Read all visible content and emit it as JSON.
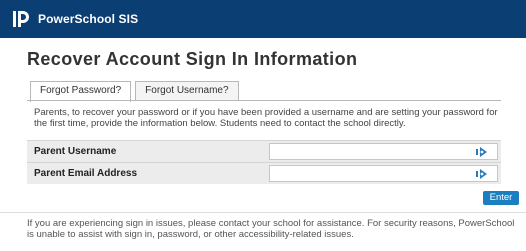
{
  "header": {
    "brand": "PowerSchool SIS",
    "logo_icon": "powerschool-logo-icon"
  },
  "page": {
    "title": "Recover Account Sign In Information"
  },
  "tabs": [
    {
      "label": "Forgot Password?",
      "active": true
    },
    {
      "label": "Forgot Username?",
      "active": false
    }
  ],
  "intro": "Parents, to recover your password or if you have been provided a username and are setting your password for the first time, provide the information below. Students need to contact the school directly.",
  "form": {
    "fields": [
      {
        "label": "Parent Username",
        "value": "",
        "icon": "password-manager-icon"
      },
      {
        "label": "Parent Email Address",
        "value": "",
        "icon": "password-manager-icon"
      }
    ],
    "submit_label": "Enter"
  },
  "footer_note": "If you are experiencing sign in issues, please contact your school for assistance. For security reasons, PowerSchool is unable to assist with sign in, password, or other accessibility-related issues.",
  "colors": {
    "header_bg": "#0b3e73",
    "button_bg": "#1a7fc1",
    "row_bg": "#ececec"
  }
}
